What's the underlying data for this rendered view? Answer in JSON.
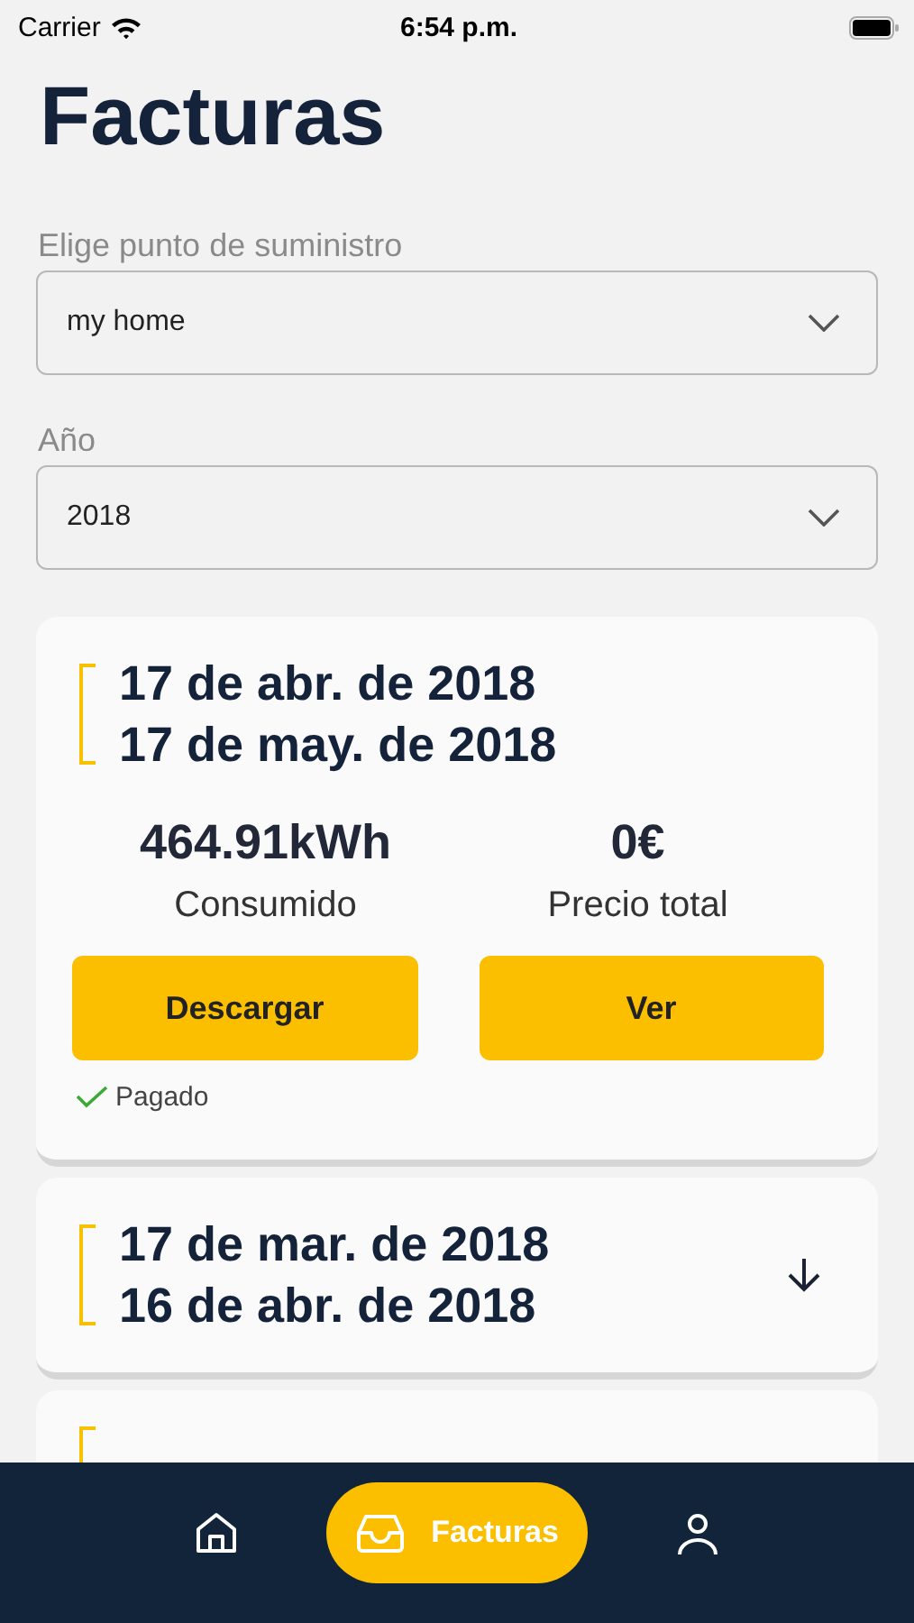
{
  "status_bar": {
    "carrier": "Carrier",
    "time": "6:54 p.m."
  },
  "title": "Facturas",
  "supply_point": {
    "label": "Elige punto de suministro",
    "value": "my home"
  },
  "year": {
    "label": "Año",
    "value": "2018"
  },
  "invoices": [
    {
      "start": "17 de abr. de 2018",
      "end": "17 de may. de 2018",
      "expanded": true,
      "consumption": "464.91kWh",
      "consumption_label": "Consumido",
      "price": "0€",
      "price_label": "Precio total",
      "download": "Descargar",
      "view": "Ver",
      "paid": true,
      "paid_label": "Pagado"
    },
    {
      "start": "17 de mar. de 2018",
      "end": "16 de abr. de 2018",
      "expanded": false
    },
    {
      "expanded": false
    }
  ],
  "tab_bar": [
    {
      "kind": "home",
      "selected": false
    },
    {
      "kind": "invoices",
      "label": "Facturas",
      "selected": true
    },
    {
      "kind": "profile",
      "selected": false
    }
  ]
}
